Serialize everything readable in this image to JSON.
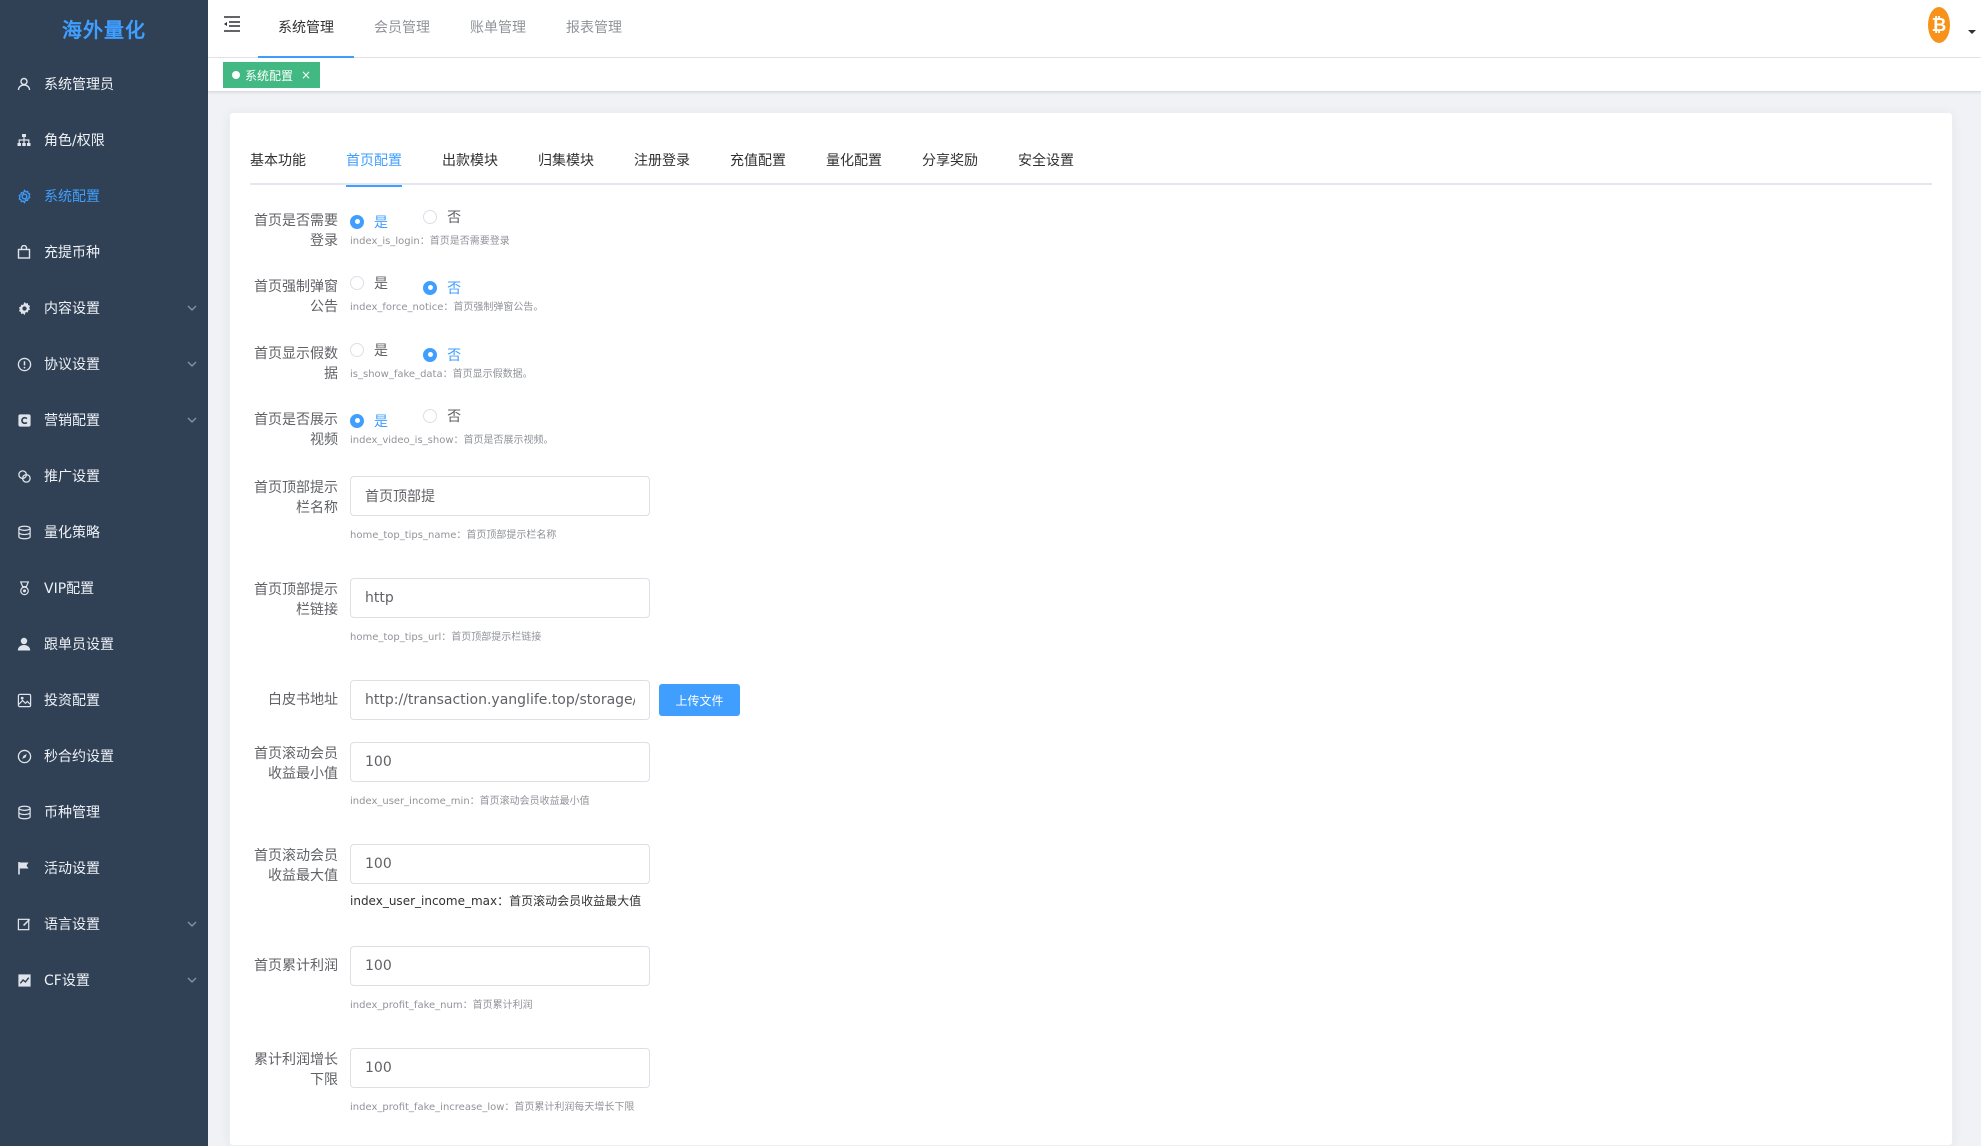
{
  "app": {
    "logo": "海外量化"
  },
  "sidebar": {
    "items": [
      {
        "label": "系统管理员",
        "icon": "user-icon"
      },
      {
        "label": "角色/权限",
        "icon": "hierarchy-icon"
      },
      {
        "label": "系统配置",
        "icon": "gear-icon",
        "active": true
      },
      {
        "label": "充提币种",
        "icon": "bag-icon"
      },
      {
        "label": "内容设置",
        "icon": "cog-icon",
        "submenu": true
      },
      {
        "label": "协议设置",
        "icon": "info-icon",
        "submenu": true
      },
      {
        "label": "营销配置",
        "icon": "marketing-icon",
        "submenu": true
      },
      {
        "label": "推广设置",
        "icon": "link-icon"
      },
      {
        "label": "量化策略",
        "icon": "database-icon"
      },
      {
        "label": "VIP配置",
        "icon": "medal-icon"
      },
      {
        "label": "跟单员设置",
        "icon": "person-icon"
      },
      {
        "label": "投资配置",
        "icon": "photo-icon"
      },
      {
        "label": "秒合约设置",
        "icon": "compass-icon"
      },
      {
        "label": "币种管理",
        "icon": "coins-icon"
      },
      {
        "label": "活动设置",
        "icon": "flag-icon"
      },
      {
        "label": "语言设置",
        "icon": "edit-icon",
        "submenu": true
      },
      {
        "label": "CF设置",
        "icon": "chart-icon",
        "submenu": true
      }
    ]
  },
  "header": {
    "tabs": [
      "系统管理",
      "会员管理",
      "账单管理",
      "报表管理"
    ],
    "active_tab": 0
  },
  "tagsview": {
    "tag": "系统配置",
    "close": "×"
  },
  "sub_tabs": {
    "items": [
      "基本功能",
      "首页配置",
      "出款模块",
      "归集模块",
      "注册登录",
      "充值配置",
      "量化配置",
      "分享奖励",
      "安全设置"
    ],
    "active": 1
  },
  "form": {
    "login": {
      "label_1": "首页是否需要",
      "label_2": "登录",
      "opt_yes": "是",
      "opt_no": "否",
      "hint": "index_is_login：首页是否需要登录"
    },
    "notice": {
      "label_1": "首页强制弹窗",
      "label_2": "公告",
      "opt_yes": "是",
      "opt_no": "否",
      "hint": "index_force_notice：首页强制弹窗公告。"
    },
    "fake": {
      "label_1": "首页显示假数",
      "label_2": "据",
      "opt_yes": "是",
      "opt_no": "否",
      "hint": "is_show_fake_data：首页显示假数据。"
    },
    "video": {
      "label_1": "首页是否展示",
      "label_2": "视频",
      "opt_yes": "是",
      "opt_no": "否",
      "hint": "index_video_is_show：首页是否展示视频。"
    },
    "tips_name": {
      "label_1": "首页顶部提示",
      "label_2": "栏名称",
      "value": "首页顶部提",
      "hint": "home_top_tips_name：首页顶部提示栏名称"
    },
    "tips_url": {
      "label_1": "首页顶部提示",
      "label_2": "栏链接",
      "value": "http",
      "hint": "home_top_tips_url：首页顶部提示栏链接"
    },
    "whitepaper": {
      "label": "白皮书地址",
      "value": "http://transaction.yanglife.top/storage/voice/",
      "button": "上传文件"
    },
    "income_min": {
      "label_1": "首页滚动会员",
      "label_2": "收益最小值",
      "value": "100",
      "hint": "index_user_income_min：首页滚动会员收益最小值"
    },
    "income_max": {
      "label_1": "首页滚动会员",
      "label_2": "收益最大值",
      "value": "100",
      "hint": "index_user_income_max：首页滚动会员收益最大值"
    },
    "profit": {
      "label": "首页累计利润",
      "value": "100",
      "hint": "index_profit_fake_num：首页累计利润"
    },
    "increase_low": {
      "label_1": "累计利润增长",
      "label_2": "下限",
      "value": "100",
      "hint": "index_profit_fake_increase_low：首页累计利润每天增长下限"
    }
  },
  "colors": {
    "sidebar_bg": "#304156",
    "accent": "#409eff",
    "tag_green": "#42b983",
    "bitcoin": "#f7931a"
  }
}
